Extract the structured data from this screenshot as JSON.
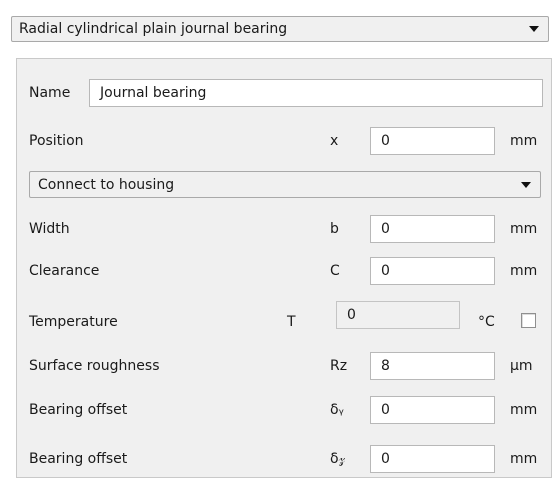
{
  "bearing_type": {
    "selected": "Radial cylindrical plain journal bearing"
  },
  "name": {
    "label": "Name",
    "value": "Journal bearing"
  },
  "position": {
    "label": "Position",
    "symbol": "x",
    "value": "0",
    "unit": "mm"
  },
  "connection": {
    "selected": "Connect to housing"
  },
  "width": {
    "label": "Width",
    "symbol": "b",
    "value": "0",
    "unit": "mm"
  },
  "clearance": {
    "label": "Clearance",
    "symbol": "C",
    "value": "0",
    "unit": "mm"
  },
  "temperature": {
    "label": "Temperature",
    "symbol": "T",
    "value": "0",
    "unit": "°C",
    "checked": false
  },
  "roughness": {
    "label": "Surface roughness",
    "symbol": "Rz",
    "value": "8",
    "unit": "µm"
  },
  "offset_y": {
    "label": "Bearing offset",
    "symbol": "δᵧ",
    "value": "0",
    "unit": "mm"
  },
  "offset_z": {
    "label": "Bearing offset",
    "symbol": "δ𝓏",
    "value": "0",
    "unit": "mm"
  },
  "icons": {
    "dropdown": "chevron-down-icon",
    "checkbox": "checkbox-icon"
  }
}
